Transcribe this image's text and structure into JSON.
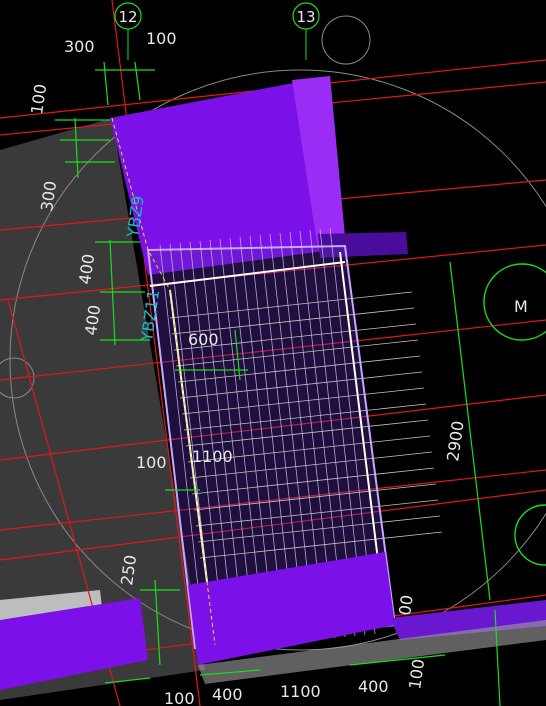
{
  "axes": {
    "a12": "12",
    "a13": "13"
  },
  "dims": {
    "top_300": "300",
    "top_100": "100",
    "left_100": "100",
    "left_300": "300",
    "left_400a": "400",
    "left_400b": "400",
    "d600": "600",
    "d100_mid": "100",
    "d1100_mid": "1100",
    "d250": "250",
    "d2900": "2900",
    "d100_r": "00",
    "bottom_100": "100",
    "bottom_400a": "400",
    "bottom_1100": "1100",
    "bottom_400b": "400",
    "bottom_100b": "100"
  },
  "labels": {
    "ybz9": "YBZ9",
    "ybz11": "YBZ11",
    "m": "M"
  },
  "colors": {
    "bg": "#000000",
    "grid_red": "#e01818",
    "purple": "#7b10e8",
    "purple_light": "#9a48f0",
    "dim_green": "#18e018",
    "gray_slab": "#3a3a3a"
  }
}
